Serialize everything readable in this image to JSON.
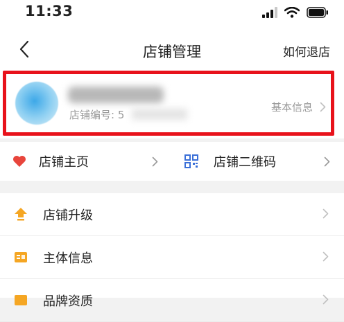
{
  "status_bar": {
    "time": "11:33"
  },
  "nav": {
    "back": "<",
    "title": "店铺管理",
    "right_link": "如何退店"
  },
  "shop": {
    "id_label": "店铺编号: 5",
    "basic_info": "基本信息"
  },
  "quick_links": [
    {
      "label": "店铺主页",
      "icon": "heart-icon"
    },
    {
      "label": "店铺二维码",
      "icon": "qr-code-icon"
    }
  ],
  "menu": [
    {
      "label": "店铺升级",
      "icon": "upgrade-arrow-icon"
    },
    {
      "label": "主体信息",
      "icon": "info-card-icon"
    },
    {
      "label": "品牌资质",
      "icon": "brand-icon"
    }
  ],
  "colors": {
    "highlight": "#e8121b",
    "heart": "#e8453c",
    "qr": "#3a6fd8",
    "orange": "#f5a623"
  }
}
